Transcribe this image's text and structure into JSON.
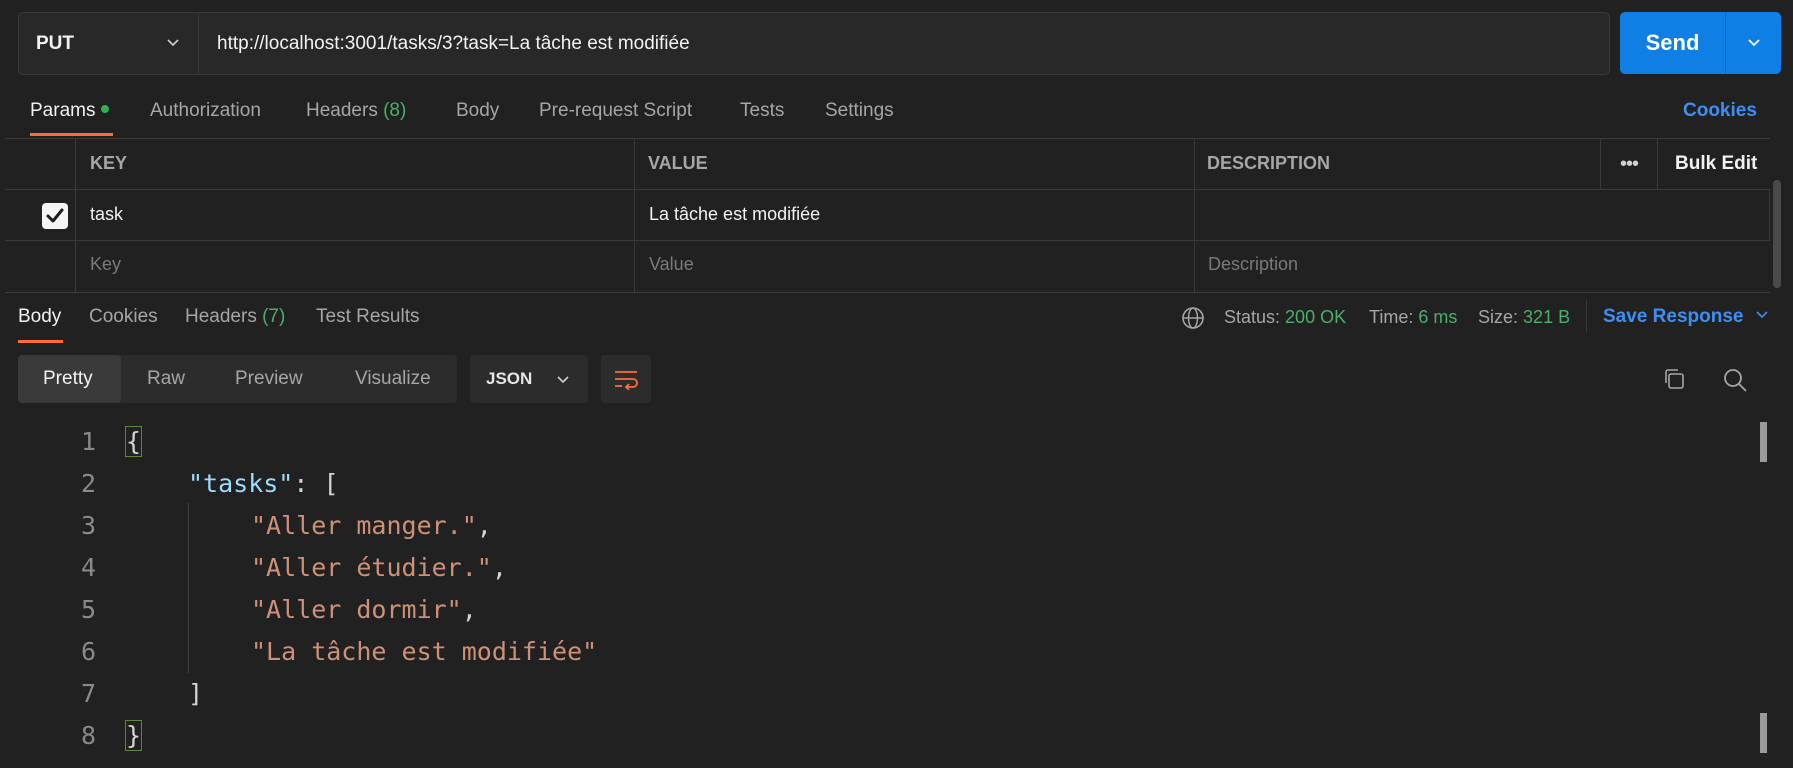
{
  "request": {
    "method": "PUT",
    "url": "http://localhost:3001/tasks/3?task=La tâche est modifiée",
    "send_label": "Send"
  },
  "request_tabs": {
    "params": "Params",
    "authorization": "Authorization",
    "headers": "Headers",
    "headers_count": "(8)",
    "body": "Body",
    "prerequest": "Pre-request Script",
    "tests": "Tests",
    "settings": "Settings",
    "cookies": "Cookies"
  },
  "params_table": {
    "col_key": "KEY",
    "col_value": "VALUE",
    "col_description": "DESCRIPTION",
    "more": "•••",
    "bulk_edit": "Bulk Edit",
    "row": {
      "key": "task",
      "value": "La tâche est modifiée",
      "description": "",
      "checked": true
    },
    "placeholder_key": "Key",
    "placeholder_value": "Value",
    "placeholder_description": "Description"
  },
  "response_tabs": {
    "body": "Body",
    "cookies": "Cookies",
    "headers": "Headers",
    "headers_count": "(7)",
    "test_results": "Test Results"
  },
  "response_meta": {
    "status_label": "Status:",
    "status_value": "200 OK",
    "time_label": "Time:",
    "time_value": "6 ms",
    "size_label": "Size:",
    "size_value": "321 B",
    "save_response": "Save Response"
  },
  "viewer": {
    "pretty": "Pretty",
    "raw": "Raw",
    "preview": "Preview",
    "visualize": "Visualize",
    "format": "JSON"
  },
  "code": {
    "line_numbers": [
      "1",
      "2",
      "3",
      "4",
      "5",
      "6",
      "7",
      "8"
    ],
    "open_brace": "{",
    "tasks_key": "\"tasks\"",
    "colon_bracket": ": [",
    "items": [
      "\"Aller manger.\"",
      "\"Aller étudier.\"",
      "\"Aller dormir\"",
      "\"La tâche est modifiée\""
    ],
    "comma": ",",
    "close_bracket": "]",
    "close_brace": "}"
  },
  "colors": {
    "accent": "#ff6c37",
    "send_button": "#0f7fe6",
    "link": "#3e8ff5",
    "success": "#4caf68",
    "json_key": "#9cdcfe",
    "json_string": "#ce9178"
  }
}
